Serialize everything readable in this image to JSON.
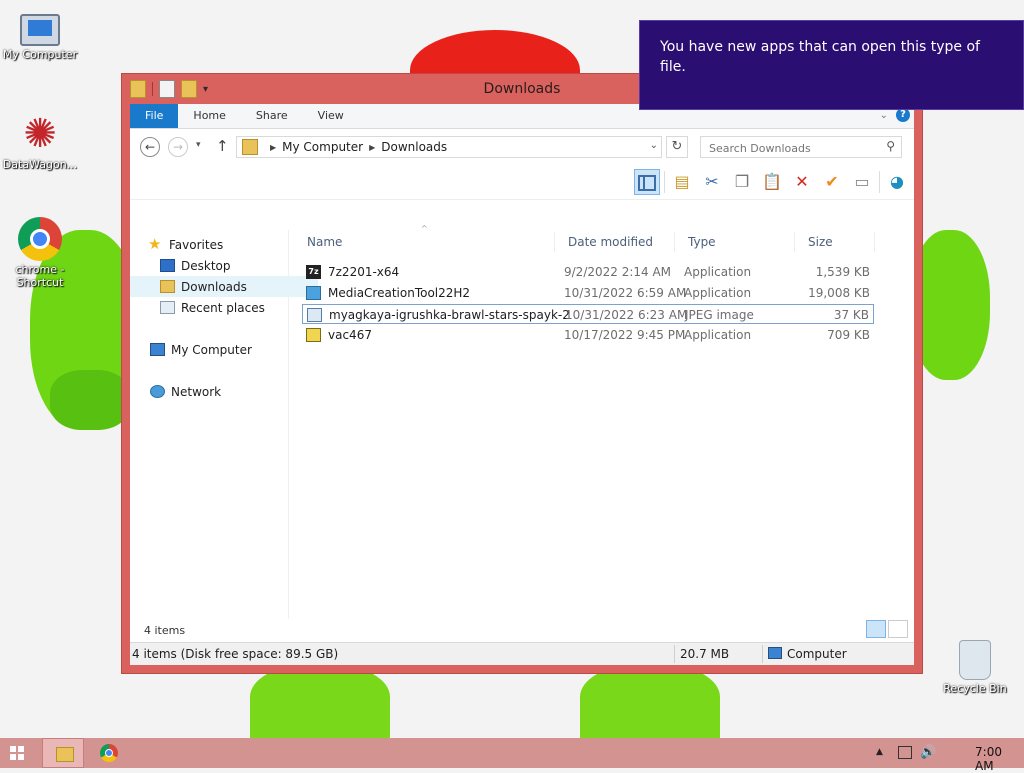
{
  "desktop": {
    "icons": [
      {
        "label": "My Computer",
        "icon": "computer-icon"
      },
      {
        "label": "DataWagon...",
        "icon": "datawagon-icon"
      },
      {
        "label": "chrome - Shortcut",
        "icon": "chrome-icon"
      },
      {
        "label": "Recycle Bin",
        "icon": "recycle-bin-icon"
      }
    ]
  },
  "toast": {
    "message": "You have new apps that can open this type of file.",
    "background": "#2b0e72"
  },
  "window": {
    "title": "Downloads",
    "frame_color": "#d9625e",
    "ribbon_tabs": [
      "File",
      "Home",
      "Share",
      "View"
    ],
    "address": {
      "crumbs": [
        "My Computer",
        "Downloads"
      ]
    },
    "search": {
      "placeholder": "Search Downloads"
    },
    "nav": {
      "favorites_label": "Favorites",
      "items": [
        "Desktop",
        "Downloads",
        "Recent places"
      ],
      "selected": "Downloads",
      "computer_label": "My Computer",
      "network_label": "Network"
    },
    "columns": [
      "Name",
      "Date modified",
      "Type",
      "Size"
    ],
    "files": [
      {
        "name": "7z2201-x64",
        "date": "9/2/2022 2:14 AM",
        "type": "Application",
        "size": "1,539 KB",
        "icon": "7zip-icon"
      },
      {
        "name": "MediaCreationTool22H2",
        "date": "10/31/2022 6:59 AM",
        "type": "Application",
        "size": "19,008 KB",
        "icon": "media-creation-tool-icon"
      },
      {
        "name": "myagkaya-igrushka-brawl-stars-spayk-2",
        "date": "10/31/2022 6:23 AM",
        "type": "JPEG image",
        "size": "37 KB",
        "icon": "jpeg-image-icon",
        "selected": true
      },
      {
        "name": "vac467",
        "date": "10/17/2022 9:45 PM",
        "type": "Application",
        "size": "709 KB",
        "icon": "application-icon"
      }
    ],
    "item_count": "4 items",
    "status": {
      "summary": "4 items (Disk free space: 89.5 GB)",
      "size": "20.7 MB",
      "location": "Computer"
    }
  },
  "taskbar": {
    "time": "7:00 AM",
    "color": "#d39391"
  }
}
